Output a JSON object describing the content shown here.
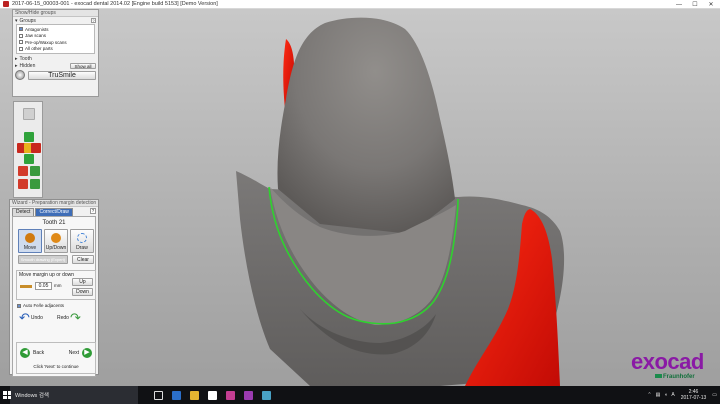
{
  "window": {
    "title": "2017-06-15_00003-001 - exocad dental 2014.02 [Engine build 5153] [Demo Version]",
    "controls": [
      "—",
      "☐",
      "✕"
    ]
  },
  "groups_panel": {
    "header": "Show/Hide groups",
    "groups_label": "Groups",
    "help": "?",
    "items": [
      {
        "label": "Antagonists",
        "checked": true
      },
      {
        "label": "Jaw scans",
        "checked": false
      },
      {
        "label": "Pre-op/Waxup scans",
        "checked": false
      },
      {
        "label": "All other parts",
        "checked": false
      }
    ],
    "tooth_label": "Tooth",
    "hidden_label": "Hidden",
    "show_all": "Show all",
    "trusmile": "TruSmile"
  },
  "wizard": {
    "header": "Wizard - Preparation margin detection",
    "tabs": [
      "Detect",
      "Correct/Draw"
    ],
    "help": "?",
    "tooth_title": "Tooth 21",
    "buttons": {
      "move": "Move",
      "updown": "Up/Down",
      "draw": "Draw"
    },
    "faded_button": "Smooth drawing (Expert)",
    "clear": "Clear",
    "move_margin_label": "Move margin up or down",
    "offset_value": "0.05",
    "unit": "mm",
    "up": "Up",
    "down": "Down",
    "auto_fix_label": "Auto Fe/le adjacents",
    "undo": "Undo",
    "redo": "Redo",
    "back": "Back",
    "next": "Next",
    "hint": "Click 'Next' to continue"
  },
  "branding": {
    "logo": "exocad",
    "partner": "Fraunhofer"
  },
  "taskbar": {
    "search_placeholder": "Windows 검색",
    "time": "2:46",
    "date": "2017-07-13",
    "lang": "A"
  },
  "colors": {
    "accent_blue": "#3e6db7",
    "margin_line": "#2fd22f",
    "prep_red": "#e0180f",
    "brand_purple": "#8a1aa5"
  }
}
